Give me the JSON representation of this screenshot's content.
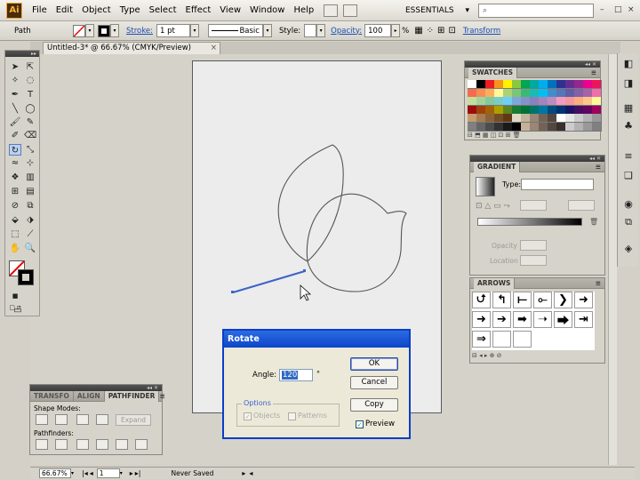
{
  "app": {
    "logo": "Ai"
  },
  "menu": [
    "File",
    "Edit",
    "Object",
    "Type",
    "Select",
    "Effect",
    "View",
    "Window",
    "Help"
  ],
  "workspace": "ESSENTIALS",
  "window_controls": [
    "–",
    "□",
    "×"
  ],
  "control_bar": {
    "selection_type": "Path",
    "stroke_label": "Stroke:",
    "stroke_weight": "1 pt",
    "brush": "Basic",
    "style_label": "Style:",
    "opacity_label": "Opacity:",
    "opacity_value": "100",
    "opacity_unit": "%",
    "transform_label": "Transform"
  },
  "document": {
    "tab_title": "Untitled-3* @ 66.67% (CMYK/Preview)"
  },
  "panels": {
    "swatches_title": "SWATCHES",
    "gradient_title": "GRADIENT",
    "gradient_type_label": "Type:",
    "gradient_opacity_label": "Opacity",
    "gradient_location_label": "Location",
    "arrows_title": "ARROWS",
    "transform_tab": "TRANSFO",
    "align_tab": "ALIGN",
    "pathfinder_tab": "PATHFINDER",
    "shape_modes_label": "Shape Modes:",
    "pathfinders_label": "Pathfinders:",
    "expand_label": "Expand"
  },
  "swatch_colors": [
    [
      "#ffffff",
      "#000000",
      "#ed1c24",
      "#f7941d",
      "#fff200",
      "#8dc63f",
      "#00a651",
      "#00a99d",
      "#00aeef",
      "#0072bc",
      "#2e3192",
      "#662d91",
      "#92278f",
      "#ec008c",
      "#ed145b"
    ],
    [
      "#f26c4f",
      "#f68e56",
      "#fbaf5d",
      "#fff799",
      "#acd373",
      "#7cc576",
      "#3bb878",
      "#1abbb4",
      "#00bff3",
      "#438ccb",
      "#5574b9",
      "#605ca8",
      "#855fa8",
      "#a763a8",
      "#f06ea9"
    ],
    [
      "#c4df9b",
      "#a3d39c",
      "#82ca9c",
      "#7accc8",
      "#6dcff6",
      "#7da7d9",
      "#8393ca",
      "#8781bd",
      "#a186be",
      "#bd8cbf",
      "#f49ac1",
      "#f5989d",
      "#f9ad81",
      "#fdc689",
      "#fff79a"
    ],
    [
      "#9e0b0f",
      "#a0410d",
      "#a36209",
      "#aba000",
      "#598527",
      "#1a7b30",
      "#007236",
      "#00746b",
      "#0076a3",
      "#004b80",
      "#003471",
      "#1b1464",
      "#440e62",
      "#630460",
      "#9e005d"
    ],
    [
      "#c69c6d",
      "#a67c52",
      "#8c6239",
      "#754c24",
      "#603913",
      "#e0d8c8",
      "#c2b59b",
      "#998675",
      "#736357",
      "#534741",
      "#ffffff",
      "#e6e6e6",
      "#cccccc",
      "#b3b3b3",
      "#999999"
    ],
    [
      "#808080",
      "#666666",
      "#4d4d4d",
      "#333333",
      "#1a1a1a",
      "#000000",
      "#c7b299",
      "#998675",
      "#736357",
      "#534741",
      "#37302d",
      "#cccccc",
      "#b3b3b3",
      "#999999",
      "#808080"
    ]
  ],
  "arrows": [
    "⮍",
    "↰",
    "⟝",
    "⟜",
    "❯",
    "➜",
    "➜",
    "➔",
    "➡",
    "➝",
    "⮕",
    "⇥",
    "⇒",
    "",
    ""
  ],
  "dialog": {
    "title": "Rotate",
    "angle_label": "Angle:",
    "angle_value": "120",
    "angle_unit": "°",
    "options_label": "Options",
    "objects_label": "Objects",
    "patterns_label": "Patterns",
    "ok": "OK",
    "cancel": "Cancel",
    "copy": "Copy",
    "preview": "Preview",
    "preview_checked": true
  },
  "status_bar": {
    "zoom": "66.67%",
    "artboard": "1",
    "save_state": "Never Saved"
  }
}
